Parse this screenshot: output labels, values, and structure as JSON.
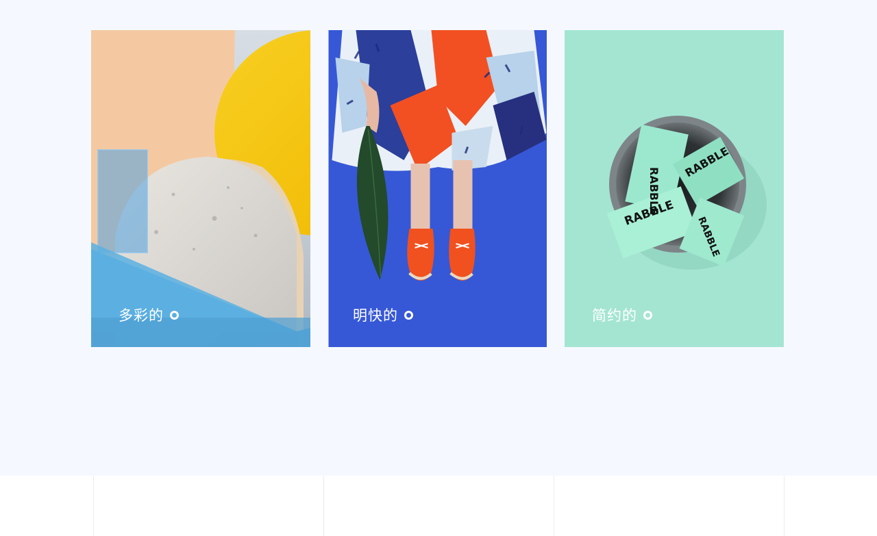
{
  "cards": [
    {
      "caption": "多彩的",
      "theme": "colorful"
    },
    {
      "caption": "明快的",
      "theme": "bright"
    },
    {
      "caption": "简约的",
      "theme": "minimal"
    }
  ],
  "card3": {
    "box_text": "RABBLE"
  },
  "colors": {
    "hero_bg": "#f5f9ff",
    "card1_peach": "#f4c9a2",
    "card1_yellow": "#f5c400",
    "card1_blue": "#57a9dc",
    "card2_blue": "#3658d6",
    "card2_red": "#f1521e",
    "card3_mint": "#a4e5d2",
    "divider": "#ececec"
  }
}
